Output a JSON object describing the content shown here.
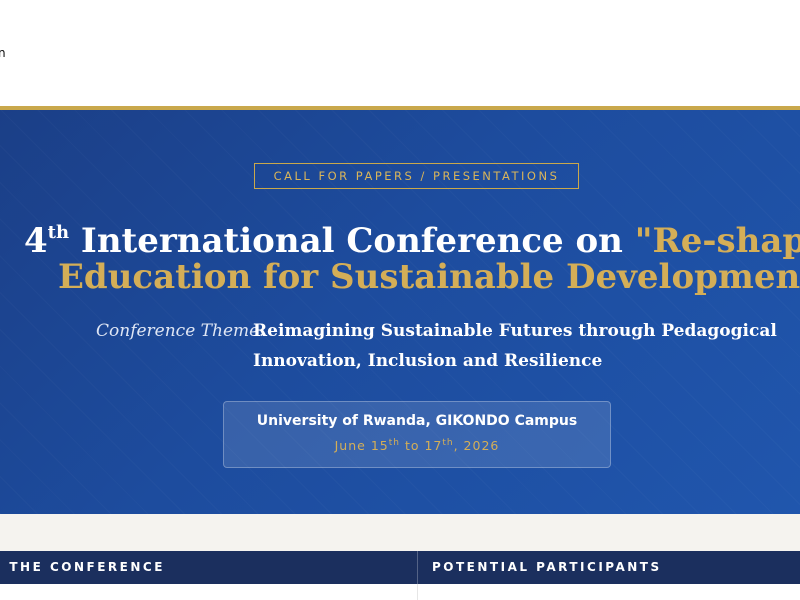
{
  "header": {
    "site_fragment": "n"
  },
  "hero": {
    "badge": "CALL FOR PAPERS / PRESENTATIONS",
    "title": {
      "ordinal_number": "4",
      "ordinal_suffix": "th",
      "line1_white": "International Conference on",
      "line1_gold": "\"Re-shaping",
      "line2": "Education for Sustainable Development\""
    },
    "theme": {
      "label": "Conference Theme:",
      "line1": "Reimagining Sustainable Futures through Pedagogical",
      "line2": "Innovation, Inclusion and Resilience"
    },
    "venue": {
      "name": "University of Rwanda, GIKONDO Campus",
      "date_prefix": "June 15",
      "date_sup1": "th",
      "date_middle": " to 17",
      "date_sup2": "th",
      "date_suffix": ", 2026"
    }
  },
  "tabs": {
    "about": "F THE CONFERENCE",
    "participants": "POTENTIAL PARTICIPANTS"
  },
  "colors": {
    "hero_blue": "#1d4c9e",
    "gold": "#d4ae57",
    "nav_navy": "#1b2f5e"
  }
}
